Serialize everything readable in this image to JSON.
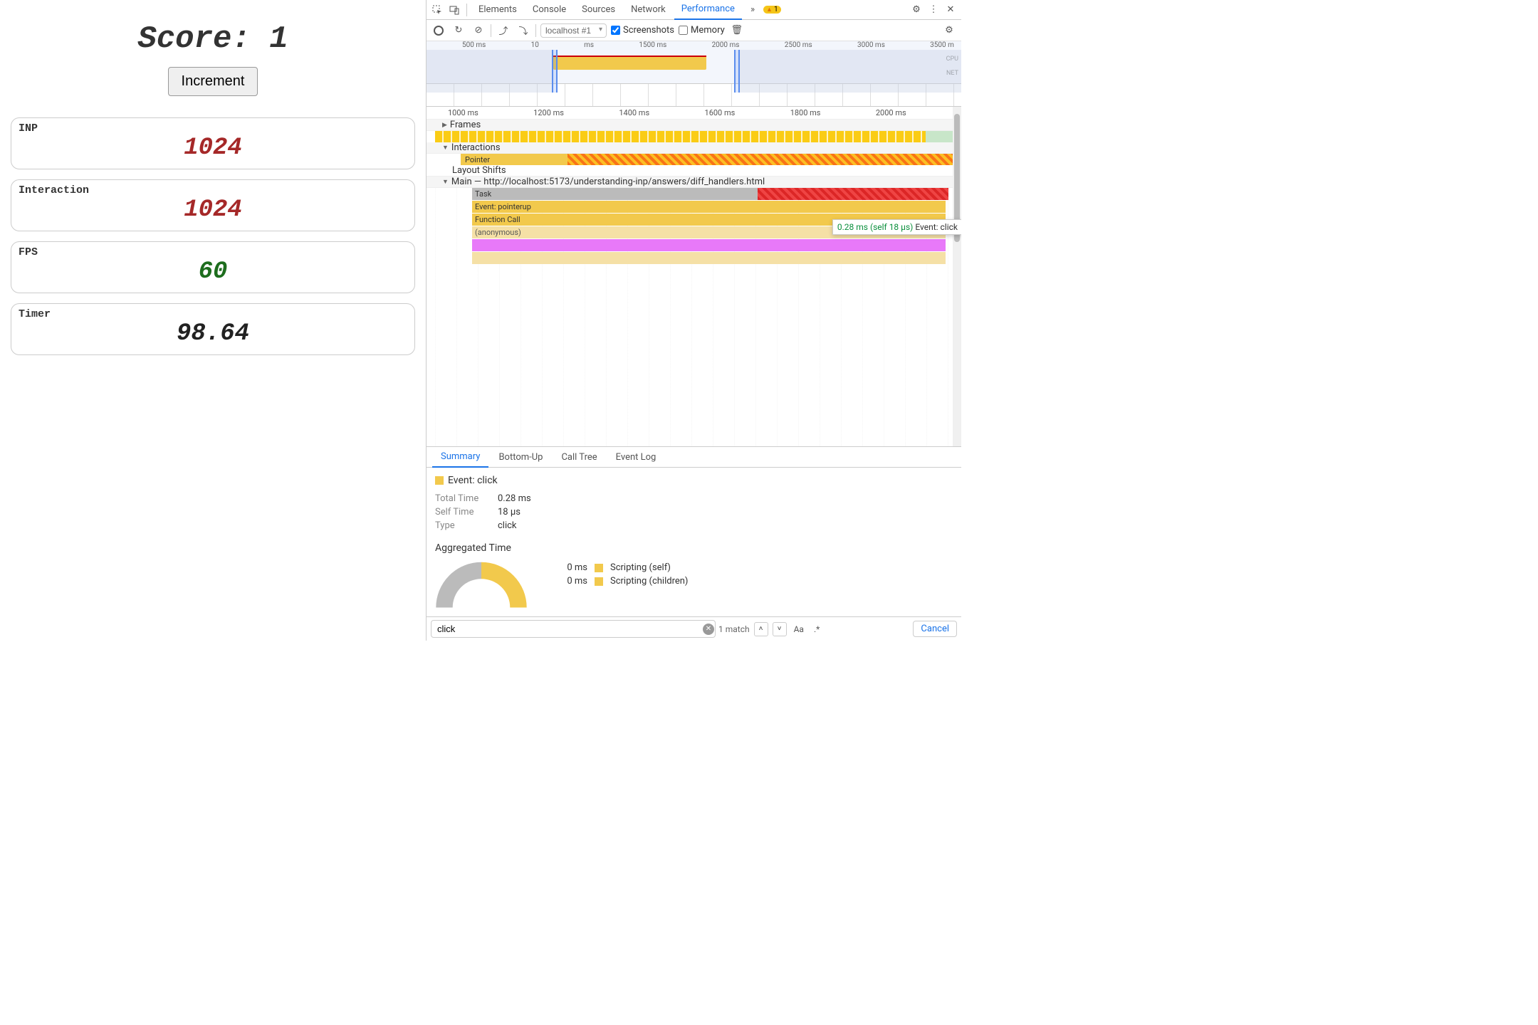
{
  "app": {
    "score_label": "Score: ",
    "score_value": "1",
    "increment": "Increment",
    "metrics": [
      {
        "label": "INP",
        "value": "1024",
        "cls": "bad"
      },
      {
        "label": "Interaction",
        "value": "1024",
        "cls": "bad"
      },
      {
        "label": "FPS",
        "value": "60",
        "cls": "good"
      },
      {
        "label": "Timer",
        "value": "98.64",
        "cls": "neutral"
      }
    ]
  },
  "devtools": {
    "tabs": [
      "Elements",
      "Console",
      "Sources",
      "Network",
      "Performance"
    ],
    "active_tab": "Performance",
    "more": "»",
    "warn_count": "1",
    "toolbar": {
      "profile_select": "localhost #1",
      "screenshots": "Screenshots",
      "memory": "Memory"
    },
    "overview_ticks": [
      "500 ms",
      "10",
      "ms",
      "1500 ms",
      "2000 ms",
      "2500 ms",
      "3000 ms",
      "3500 m"
    ],
    "overview_labels": {
      "cpu": "CPU",
      "net": "NET"
    },
    "flame_ticks": [
      "1000 ms",
      "1200 ms",
      "1400 ms",
      "1600 ms",
      "1800 ms",
      "2000 ms"
    ],
    "tracks": {
      "frames": "Frames",
      "interactions": "Interactions",
      "pointer": "Pointer",
      "layout_shifts": "Layout Shifts",
      "main": "Main — http://localhost:5173/understanding-inp/answers/diff_handlers.html"
    },
    "bars": {
      "task": "Task",
      "event": "Event: pointerup",
      "fn": "Function Call",
      "anon": "(anonymous)"
    },
    "tooltip": {
      "time": "0.28 ms (self 18 µs)",
      "label": "Event: click"
    },
    "summary_tabs": [
      "Summary",
      "Bottom-Up",
      "Call Tree",
      "Event Log"
    ],
    "summary": {
      "event": "Event: click",
      "total_time_k": "Total Time",
      "total_time_v": "0.28 ms",
      "self_time_k": "Self Time",
      "self_time_v": "18 µs",
      "type_k": "Type",
      "type_v": "click",
      "agg_title": "Aggregated Time",
      "agg_rows": [
        {
          "v": "0 ms",
          "label": "Scripting (self)"
        },
        {
          "v": "0 ms",
          "label": "Scripting (children)"
        }
      ]
    },
    "search": {
      "value": "click",
      "match": "1 match",
      "aa": "Aa",
      "regex": ".*",
      "cancel": "Cancel"
    }
  }
}
